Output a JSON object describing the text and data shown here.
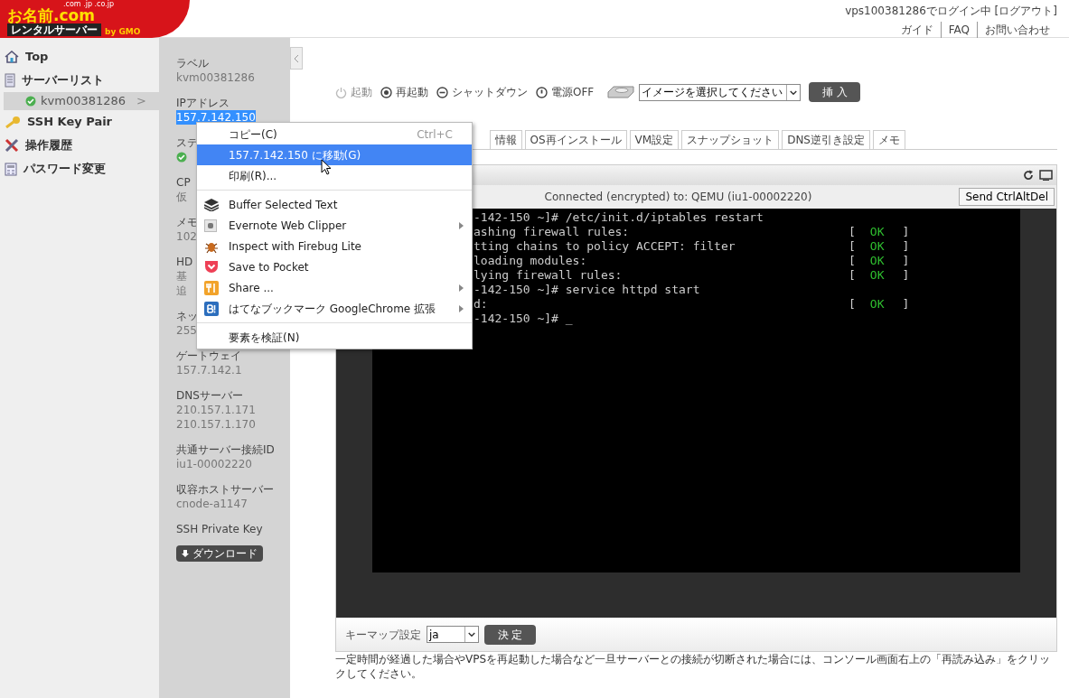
{
  "header": {
    "logo": {
      "domains": ".com .jp .co.jp",
      "brand": "お名前.com",
      "service": "レンタルサーバー",
      "by": "by GMO"
    },
    "login": "vps100381286でログイン中 [ログアウト]",
    "links": [
      "ガイド",
      "FAQ",
      "お問い合わせ"
    ]
  },
  "sidebar": {
    "items": [
      {
        "label": "Top",
        "selected": false
      },
      {
        "label": "サーバーリスト",
        "selected": false,
        "children": [
          {
            "label": "kvm00381286",
            "chevron": ">",
            "selected": true
          }
        ]
      },
      {
        "label": "SSH Key Pair",
        "selected": false
      },
      {
        "label": "操作履歴",
        "selected": false
      },
      {
        "label": "パスワード変更",
        "selected": false
      }
    ]
  },
  "info_panel": {
    "fields": [
      {
        "label": "ラベル",
        "values": [
          "kvm00381286"
        ],
        "highlighted": false
      },
      {
        "label": "IPアドレス",
        "values": [
          "157.7.142.150"
        ],
        "highlighted": true
      },
      {
        "label": "ステ",
        "status_ok": true,
        "highlighted": false
      },
      {
        "label": "CP",
        "values": [
          "仮"
        ],
        "highlighted": false
      },
      {
        "label": "メモ",
        "values": [
          "102"
        ],
        "highlighted": false
      },
      {
        "label": "HD",
        "values": [
          "基",
          "追"
        ],
        "highlighted": false
      },
      {
        "label": "ネッ",
        "values": [
          "255"
        ],
        "highlighted": false
      },
      {
        "label": "ゲートウェイ",
        "values": [
          "157.7.142.1"
        ],
        "highlighted": false
      },
      {
        "label": "DNSサーバー",
        "values": [
          "210.157.1.171",
          "210.157.1.170"
        ],
        "highlighted": false
      },
      {
        "label": "共通サーバー接続ID",
        "values": [
          "iu1-00002220"
        ],
        "highlighted": false
      },
      {
        "label": "収容ホストサーバー",
        "values": [
          "cnode-a1147"
        ],
        "highlighted": false
      },
      {
        "label": "SSH Private Key",
        "highlighted": false
      }
    ],
    "download_button": "ダウンロード"
  },
  "power": [
    {
      "label": "起動",
      "disabled": true
    },
    {
      "label": "再起動",
      "disabled": false
    },
    {
      "label": "シャットダウン",
      "disabled": false
    },
    {
      "label": "電源OFF",
      "disabled": false
    }
  ],
  "image_select": {
    "value": "イメージを選択してください",
    "button": "挿 入"
  },
  "tabs": [
    "情報",
    "OS再インストール",
    "VM設定",
    "スナップショット",
    "DNS逆引き設定",
    "メモ"
  ],
  "console": {
    "status": "Connected (encrypted) to: QEMU (iu1-00002220)",
    "send_button": "Send CtrlAltDel",
    "lines": [
      {
        "text": "-142-150 ~]# /etc/init.d/iptables restart"
      },
      {
        "text": "ashing firewall rules:",
        "status": [
          "[",
          "OK",
          "]"
        ]
      },
      {
        "text": "tting chains to policy ACCEPT: filter",
        "status": [
          "[",
          "OK",
          "]"
        ]
      },
      {
        "text": "loading modules:",
        "status": [
          "[",
          "OK",
          "]"
        ]
      },
      {
        "text": "lying firewall rules:",
        "status": [
          "[",
          "OK",
          "]"
        ]
      },
      {
        "text": "-142-150 ~]# service httpd start"
      },
      {
        "text": "d:",
        "status": [
          "[",
          "OK",
          "]"
        ]
      },
      {
        "text": "-142-150 ~]# _"
      }
    ],
    "keymap_label": "キーマップ設定",
    "keymap_value": "ja",
    "apply_button": "決 定"
  },
  "note": "一定時間が経過した場合やVPSを再起動した場合など一旦サーバーとの接続が切断された場合には、コンソール画面右上の「再読み込み」をクリックしてください。",
  "context_menu": {
    "groups": [
      [
        {
          "label": "コピー(C)",
          "shortcut": "Ctrl+C",
          "submenu": false,
          "selected": false
        },
        {
          "label": "157.7.142.150 に移動(G)",
          "submenu": false,
          "selected": true
        },
        {
          "label": "印刷(R)...",
          "submenu": false,
          "selected": false
        }
      ],
      [
        {
          "label": "Buffer Selected Text",
          "submenu": false,
          "selected": false
        },
        {
          "label": "Evernote Web Clipper",
          "submenu": true,
          "selected": false
        },
        {
          "label": "Inspect with Firebug Lite",
          "submenu": false,
          "selected": false
        },
        {
          "label": "Save to Pocket",
          "submenu": false,
          "selected": false
        },
        {
          "label": "Share ...",
          "submenu": true,
          "selected": false
        },
        {
          "label": "はてなブックマーク GoogleChrome 拡張",
          "submenu": true,
          "selected": false
        }
      ],
      [
        {
          "label": "要素を検証(N)",
          "submenu": false,
          "selected": false
        }
      ]
    ]
  }
}
